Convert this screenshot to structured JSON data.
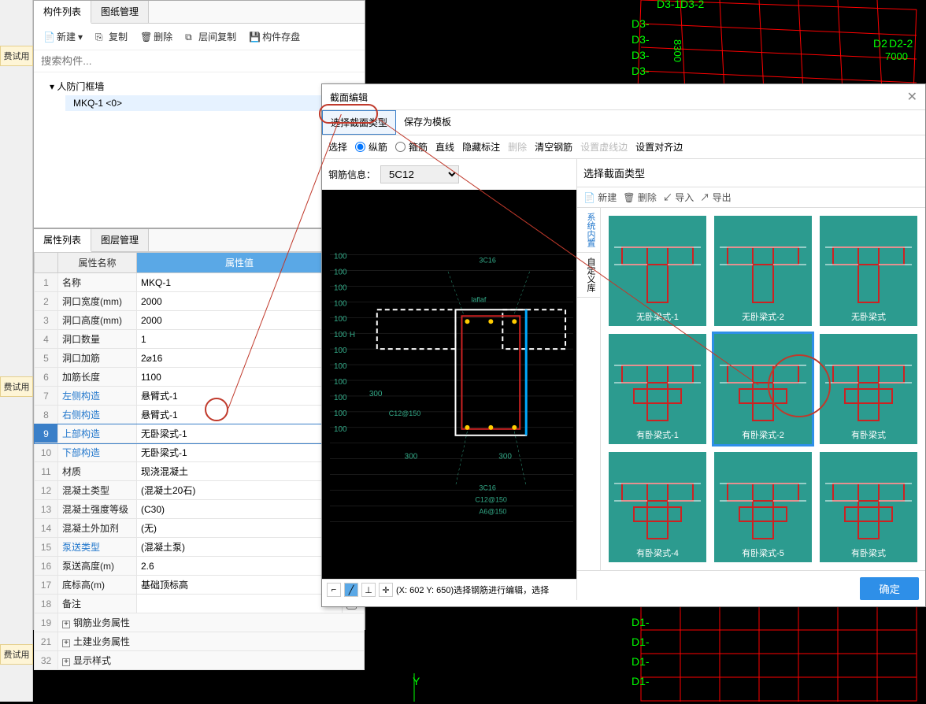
{
  "left_tags": [
    "费试用",
    "费试用",
    "费试用"
  ],
  "component_panel": {
    "tabs": [
      "构件列表",
      "图纸管理"
    ],
    "toolbar": {
      "new": "新建",
      "copy": "复制",
      "delete": "删除",
      "layer_copy": "层间复制",
      "save": "构件存盘"
    },
    "search_placeholder": "搜索构件...",
    "tree_root": "人防门框墙",
    "tree_child": "MKQ-1 <0>"
  },
  "property_panel": {
    "tabs": [
      "属性列表",
      "图层管理"
    ],
    "headers": {
      "name": "属性名称",
      "value": "属性值"
    },
    "rows": [
      {
        "n": "1",
        "k": "名称",
        "v": "MKQ-1"
      },
      {
        "n": "2",
        "k": "洞口宽度(mm)",
        "v": "2000"
      },
      {
        "n": "3",
        "k": "洞口高度(mm)",
        "v": "2000"
      },
      {
        "n": "4",
        "k": "洞口数量",
        "v": "1"
      },
      {
        "n": "5",
        "k": "洞口加筋",
        "v": "2⌀16"
      },
      {
        "n": "6",
        "k": "加筋长度",
        "v": "1100"
      },
      {
        "n": "7",
        "k": "左侧构造",
        "v": "悬臂式-1",
        "link": true
      },
      {
        "n": "8",
        "k": "右侧构造",
        "v": "悬臂式-1",
        "link": true
      },
      {
        "n": "9",
        "k": "上部构造",
        "v": "无卧梁式-1",
        "link": true,
        "hl": true
      },
      {
        "n": "10",
        "k": "下部构造",
        "v": "无卧梁式-1",
        "link": true
      },
      {
        "n": "11",
        "k": "材质",
        "v": "现浇混凝土"
      },
      {
        "n": "12",
        "k": "混凝土类型",
        "v": "(混凝土20石)"
      },
      {
        "n": "13",
        "k": "混凝土强度等级",
        "v": "(C30)"
      },
      {
        "n": "14",
        "k": "混凝土外加剂",
        "v": "(无)"
      },
      {
        "n": "15",
        "k": "泵送类型",
        "v": "(混凝土泵)",
        "link": true
      },
      {
        "n": "16",
        "k": "泵送高度(m)",
        "v": "2.6"
      },
      {
        "n": "17",
        "k": "底标高(m)",
        "v": "基础顶标高",
        "cb": true
      },
      {
        "n": "18",
        "k": "备注",
        "v": "",
        "cb": true
      }
    ],
    "groups": [
      {
        "n": "19",
        "k": "钢筋业务属性"
      },
      {
        "n": "21",
        "k": "土建业务属性"
      },
      {
        "n": "32",
        "k": "显示样式"
      }
    ]
  },
  "section_dialog": {
    "title": "截面编辑",
    "mode_tabs": [
      "选择截面类型",
      "保存为模板"
    ],
    "tool_select": "选择",
    "tool_long": "纵筋",
    "tool_stirrup": "箍筋",
    "tools_right": [
      "直线",
      "隐藏标注",
      "删除",
      "清空钢筋",
      "设置虚线边",
      "设置对齐边"
    ],
    "tools_disabled": {
      "delete": true,
      "setdash": true
    },
    "info_label": "钢筋信息：",
    "info_value": "5C12",
    "status": "(X: 602 Y: 650)选择钢筋进行编辑，选择",
    "right_title": "选择截面类型",
    "right_toolbar": [
      "新建",
      "删除",
      "导入",
      "导出"
    ],
    "side_tabs": [
      "系统内置",
      "自定义库"
    ],
    "cards": [
      "无卧梁式-1",
      "无卧梁式-2",
      "无卧梁式",
      "有卧梁式-1",
      "有卧梁式-2",
      "有卧梁式",
      "有卧梁式-4",
      "有卧梁式-5",
      "有卧梁式"
    ],
    "selected_card": 4,
    "ok": "确定"
  },
  "canvas_labels": {
    "d3_1": "D3-1",
    "d3_2": "D3-2",
    "d3_a": "D3-",
    "d3_b": "D3-",
    "d3_c": "D3-",
    "d3_d": "D3-",
    "n8300": "8300",
    "d2": "D2",
    "d2_2": "D2-2",
    "n7000": "7000",
    "d1_1": "D1-",
    "d1_2": "D1-",
    "d1_3": "D1-",
    "d1_4": "D1-",
    "y": "Y",
    "s_3c16a": "3C16",
    "s_3c16b": "3C16",
    "s_c12": "C12@150",
    "s_c12b": "C12@150",
    "s_a6": "A6@150",
    "s_laf": "laflaf",
    "s_h": "H",
    "s_300a": "300",
    "s_300b": "300",
    "s_300c": "300",
    "dim100": "100"
  }
}
